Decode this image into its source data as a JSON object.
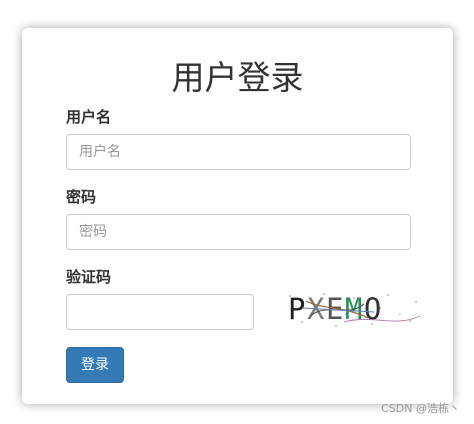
{
  "form": {
    "title": "用户登录",
    "username": {
      "label": "用户名",
      "placeholder": "用户名",
      "value": ""
    },
    "password": {
      "label": "密码",
      "placeholder": "密码",
      "value": ""
    },
    "captcha": {
      "label": "验证码",
      "value": "",
      "image_text": "PXEMO"
    },
    "submit_label": "登录"
  },
  "watermark": "CSDN @浩栋丶",
  "colors": {
    "primary_button": "#337ab7",
    "card_background": "#ffffff"
  }
}
